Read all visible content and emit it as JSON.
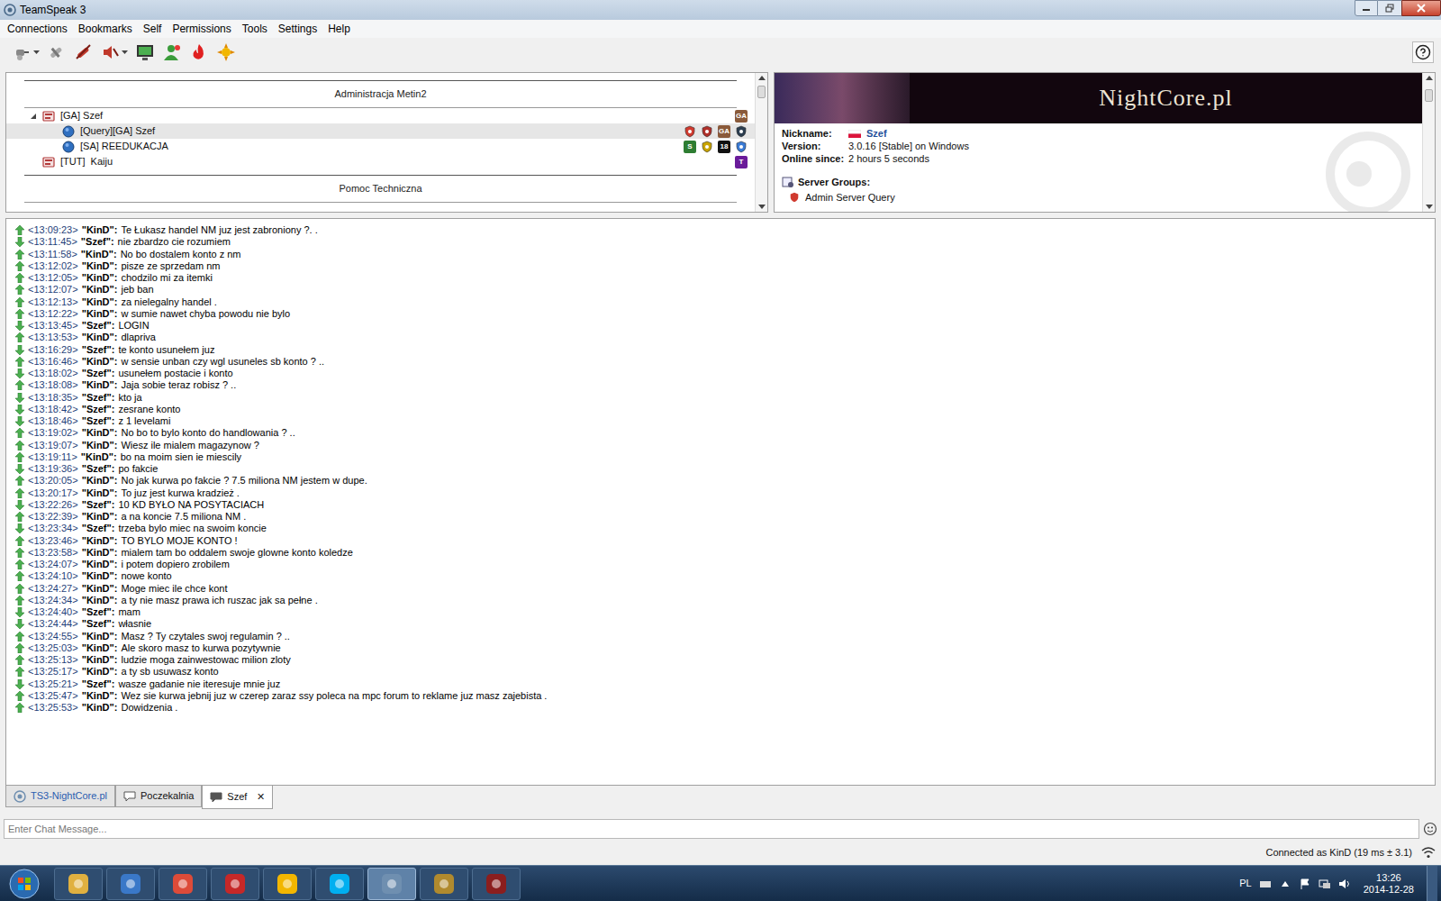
{
  "window": {
    "title": "TeamSpeak 3"
  },
  "menu": [
    "Connections",
    "Bookmarks",
    "Self",
    "Permissions",
    "Tools",
    "Settings",
    "Help"
  ],
  "channel_tree": {
    "items": [
      {
        "kind": "spacer",
        "label": "Administracja Metin2",
        "selected": false
      },
      {
        "kind": "channel",
        "label": "[GA] Szef",
        "expanded": true,
        "selected": false,
        "badges": [
          {
            "kind": "letter",
            "label": "GA",
            "color": "#8a5a3a"
          }
        ]
      },
      {
        "kind": "client",
        "label": "[Query][GA] Szef",
        "selected": true,
        "badges": [
          {
            "kind": "icon",
            "color": "#d03a2f"
          },
          {
            "kind": "icon",
            "color": "#b0302a"
          },
          {
            "kind": "letter",
            "label": "GA",
            "color": "#8a5a3a"
          },
          {
            "kind": "icon",
            "color": "#2c3e50"
          }
        ]
      },
      {
        "kind": "client",
        "label": "[SA] REEDUKACJA",
        "selected": false,
        "badges": [
          {
            "kind": "letter",
            "label": "S",
            "color": "#2e7d32"
          },
          {
            "kind": "icon",
            "color": "#c9a400"
          },
          {
            "kind": "letter",
            "label": "18",
            "color": "#111111"
          },
          {
            "kind": "icon",
            "color": "#3a7bd5"
          }
        ]
      },
      {
        "kind": "channel",
        "label": "[TUT]  Kaiju",
        "expanded": false,
        "selected": false,
        "badges": [
          {
            "kind": "letter",
            "label": "T",
            "color": "#6a1b9a"
          }
        ]
      },
      {
        "kind": "spacer",
        "label": "Pomoc Techniczna",
        "selected": false
      }
    ]
  },
  "info": {
    "banner": "NightCore.pl",
    "fields": [
      {
        "label": "Nickname:",
        "value": "Szef",
        "kind": "nick"
      },
      {
        "label": "Version:",
        "value": "3.0.16 [Stable] on Windows",
        "kind": "plain"
      },
      {
        "label": "Online since:",
        "value": "2 hours 5 seconds",
        "kind": "plain"
      }
    ],
    "server_groups": {
      "label": "Server Groups:",
      "items": [
        "Admin Server Query"
      ]
    }
  },
  "chat": {
    "messages": [
      {
        "time": "<13:09:23>",
        "author": "\"KinD\":",
        "text": "Te Łukasz handel NM juz jest zabroniony ?. .",
        "direction": "out"
      },
      {
        "time": "<13:11:45>",
        "author": "\"Szef\":",
        "text": "nie zbardzo cie rozumiem",
        "direction": "in"
      },
      {
        "time": "<13:11:58>",
        "author": "\"KinD\":",
        "text": "No bo dostalem konto z nm",
        "direction": "out"
      },
      {
        "time": "<13:12:02>",
        "author": "\"KinD\":",
        "text": "pisze ze sprzedam nm",
        "direction": "out"
      },
      {
        "time": "<13:12:05>",
        "author": "\"KinD\":",
        "text": "chodzilo mi za itemki",
        "direction": "out"
      },
      {
        "time": "<13:12:07>",
        "author": "\"KinD\":",
        "text": "jeb ban",
        "direction": "out"
      },
      {
        "time": "<13:12:13>",
        "author": "\"KinD\":",
        "text": "za nielegalny handel .",
        "direction": "out"
      },
      {
        "time": "<13:12:22>",
        "author": "\"KinD\":",
        "text": "w sumie nawet chyba powodu nie bylo",
        "direction": "out"
      },
      {
        "time": "<13:13:45>",
        "author": "\"Szef\":",
        "text": "LOGIN",
        "direction": "in"
      },
      {
        "time": "<13:13:53>",
        "author": "\"KinD\":",
        "text": "dlapriva",
        "direction": "out"
      },
      {
        "time": "<13:16:29>",
        "author": "\"Szef\":",
        "text": "te konto usunełem juz",
        "direction": "in"
      },
      {
        "time": "<13:16:46>",
        "author": "\"KinD\":",
        "text": "w sensie unban czy wgl usuneles sb konto ? ..",
        "direction": "out"
      },
      {
        "time": "<13:18:02>",
        "author": "\"Szef\":",
        "text": "usunełem postacie i konto",
        "direction": "in"
      },
      {
        "time": "<13:18:08>",
        "author": "\"KinD\":",
        "text": "Jaja sobie teraz robisz ? ..",
        "direction": "out"
      },
      {
        "time": "<13:18:35>",
        "author": "\"Szef\":",
        "text": "kto ja",
        "direction": "in"
      },
      {
        "time": "<13:18:42>",
        "author": "\"Szef\":",
        "text": "zesrane konto",
        "direction": "in"
      },
      {
        "time": "<13:18:46>",
        "author": "\"Szef\":",
        "text": "z 1 levelami",
        "direction": "in"
      },
      {
        "time": "<13:19:02>",
        "author": "\"KinD\":",
        "text": "No bo to bylo konto do handlowania ? ..",
        "direction": "out"
      },
      {
        "time": "<13:19:07>",
        "author": "\"KinD\":",
        "text": "Wiesz ile mialem magazynow ?",
        "direction": "out"
      },
      {
        "time": "<13:19:11>",
        "author": "\"KinD\":",
        "text": "bo na moim sien ie miescily",
        "direction": "out"
      },
      {
        "time": "<13:19:36>",
        "author": "\"Szef\":",
        "text": "po fakcie",
        "direction": "in"
      },
      {
        "time": "<13:20:05>",
        "author": "\"KinD\":",
        "text": "No jak kurwa po fakcie ? 7.5 miliona NM jestem w dupe.",
        "direction": "out"
      },
      {
        "time": "<13:20:17>",
        "author": "\"KinD\":",
        "text": "To juz jest kurwa kradzież .",
        "direction": "out"
      },
      {
        "time": "<13:22:26>",
        "author": "\"Szef\":",
        "text": "10 KD BYŁO NA POSYTACIACH",
        "direction": "in"
      },
      {
        "time": "<13:22:39>",
        "author": "\"KinD\":",
        "text": "a na koncie 7.5 miliona NM .",
        "direction": "out"
      },
      {
        "time": "<13:23:34>",
        "author": "\"Szef\":",
        "text": "trzeba bylo miec na swoim koncie",
        "direction": "in"
      },
      {
        "time": "<13:23:46>",
        "author": "\"KinD\":",
        "text": "TO BYLO MOJE KONTO !",
        "direction": "out"
      },
      {
        "time": "<13:23:58>",
        "author": "\"KinD\":",
        "text": "mialem tam bo oddalem swoje glowne konto koledze",
        "direction": "out"
      },
      {
        "time": "<13:24:07>",
        "author": "\"KinD\":",
        "text": "i potem dopiero zrobilem",
        "direction": "out"
      },
      {
        "time": "<13:24:10>",
        "author": "\"KinD\":",
        "text": "nowe konto",
        "direction": "out"
      },
      {
        "time": "<13:24:27>",
        "author": "\"KinD\":",
        "text": "Moge miec ile chce kont",
        "direction": "out"
      },
      {
        "time": "<13:24:34>",
        "author": "\"KinD\":",
        "text": "a ty nie masz prawa ich ruszac jak sa pełne .",
        "direction": "out"
      },
      {
        "time": "<13:24:40>",
        "author": "\"Szef\":",
        "text": "mam",
        "direction": "in"
      },
      {
        "time": "<13:24:44>",
        "author": "\"Szef\":",
        "text": "własnie",
        "direction": "in"
      },
      {
        "time": "<13:24:55>",
        "author": "\"KinD\":",
        "text": "Masz ? Ty czytales swoj regulamin ? ..",
        "direction": "out"
      },
      {
        "time": "<13:25:03>",
        "author": "\"KinD\":",
        "text": "Ale skoro masz to kurwa pozytywnie",
        "direction": "out"
      },
      {
        "time": "<13:25:13>",
        "author": "\"KinD\":",
        "text": "ludzie moga zainwestowac milion zloty",
        "direction": "out"
      },
      {
        "time": "<13:25:17>",
        "author": "\"KinD\":",
        "text": "a ty sb usuwasz konto",
        "direction": "out"
      },
      {
        "time": "<13:25:21>",
        "author": "\"Szef\":",
        "text": "wasze gadanie nie iteresuje mnie juz",
        "direction": "in"
      },
      {
        "time": "<13:25:47>",
        "author": "\"KinD\":",
        "text": "Wez sie kurwa jebnij juz w czerep zaraz ssy poleca na mpc forum to reklame juz masz zajebista .",
        "direction": "out"
      },
      {
        "time": "<13:25:53>",
        "author": "\"KinD\":",
        "text": "Dowidzenia .",
        "direction": "out"
      }
    ]
  },
  "tabs": [
    {
      "label": "TS3-NightCore.pl",
      "kind": "server",
      "selected": false
    },
    {
      "label": "Poczekalnia",
      "kind": "channel",
      "selected": false
    },
    {
      "label": "Szef",
      "kind": "private",
      "selected": true,
      "close": "✕"
    }
  ],
  "input": {
    "placeholder": "Enter Chat Message..."
  },
  "status_bar": {
    "text": "Connected as KinD (19 ms ± 3.1)"
  },
  "taskbar": {
    "apps": [
      {
        "color": "#e0b040",
        "active": false
      },
      {
        "color": "#3a78c8",
        "active": false
      },
      {
        "color": "#dd4b39",
        "active": false
      },
      {
        "color": "#c62828",
        "active": false
      },
      {
        "color": "#f2b600",
        "active": false
      },
      {
        "color": "#00aff0",
        "active": false
      },
      {
        "color": "#6f8fb0",
        "active": true
      },
      {
        "color": "#b08a2e",
        "active": false
      },
      {
        "color": "#8b1e1e",
        "active": false
      }
    ],
    "tray": {
      "language": "PL",
      "time": "13:26",
      "date": "2014-12-28"
    }
  }
}
